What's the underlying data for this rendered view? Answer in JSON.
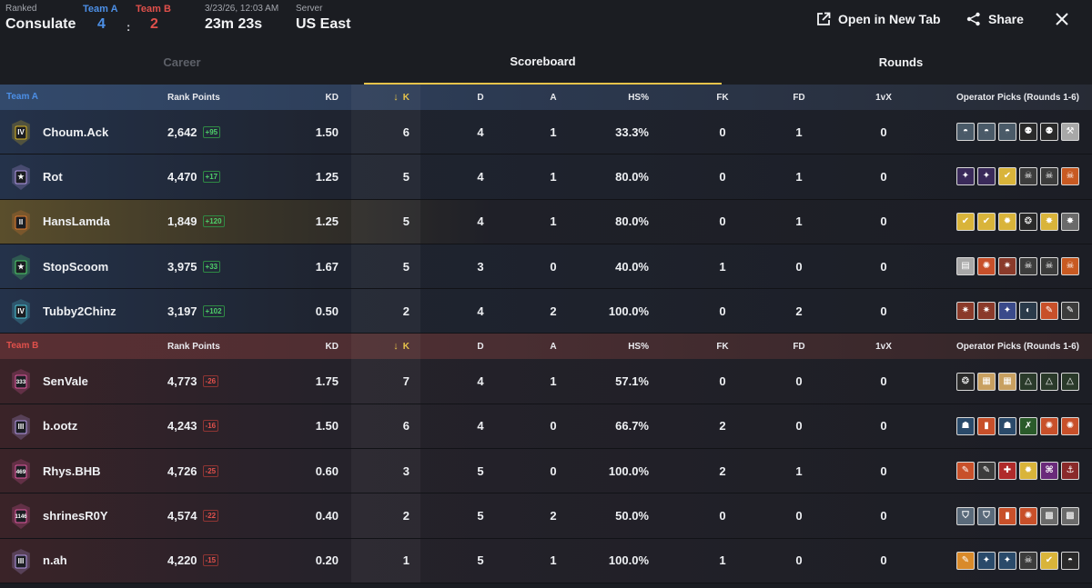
{
  "header": {
    "mode_label": "Ranked",
    "map": "Consulate",
    "team_a_label": "Team A",
    "team_a_score": "4",
    "colon": ":",
    "team_b_label": "Team B",
    "team_b_score": "2",
    "datetime": "3/23/26, 12:03 AM",
    "duration": "23m 23s",
    "server_label": "Server",
    "server": "US East",
    "open_new_tab": "Open in New Tab",
    "share": "Share"
  },
  "tabs": [
    {
      "label": "Career",
      "state": "disabled"
    },
    {
      "label": "Scoreboard",
      "state": "active"
    },
    {
      "label": "Rounds",
      "state": "normal"
    }
  ],
  "columns": {
    "rank_points": "Rank Points",
    "kd": "KD",
    "k": "K",
    "d": "D",
    "a": "A",
    "hs": "HS%",
    "fk": "FK",
    "fd": "FD",
    "vx": "1vX",
    "ops": "Operator Picks (Rounds 1-6)"
  },
  "colors": {
    "team_a": "#4c8fe6",
    "team_b": "#e0504b",
    "accent": "#e6c34a",
    "positive": "#4fcf6a"
  },
  "team_a": {
    "label": "Team A",
    "players": [
      {
        "name": "Choum.Ack",
        "rank_badge": "IV",
        "rank_color": "#d8b323",
        "rp": "2,642",
        "delta": "+95",
        "kd": "1.50",
        "k": "6",
        "d": "4",
        "a": "1",
        "hs": "33.3%",
        "fk": "0",
        "fd": "1",
        "vx": "0",
        "ops": [
          {
            "bg": "#4a5a68",
            "g": "◓"
          },
          {
            "bg": "#4a5a68",
            "g": "◓"
          },
          {
            "bg": "#4a5a68",
            "g": "◓"
          },
          {
            "bg": "#2a2a2a",
            "g": "⚉"
          },
          {
            "bg": "#2a2a2a",
            "g": "⚉"
          },
          {
            "bg": "#a8a8a8",
            "g": "⚒"
          }
        ]
      },
      {
        "name": "Rot",
        "rank_badge": "★",
        "rank_color": "#b49ae6",
        "rp": "4,470",
        "delta": "+17",
        "kd": "1.25",
        "k": "5",
        "d": "4",
        "a": "1",
        "hs": "80.0%",
        "fk": "0",
        "fd": "1",
        "vx": "0",
        "ops": [
          {
            "bg": "#3a2a5a",
            "g": "✦"
          },
          {
            "bg": "#3a2a5a",
            "g": "✦"
          },
          {
            "bg": "#d9b43a",
            "g": "✔"
          },
          {
            "bg": "#3c3c3c",
            "g": "☠"
          },
          {
            "bg": "#3c3c3c",
            "g": "☠"
          },
          {
            "bg": "#c85a22",
            "g": "☠"
          }
        ]
      },
      {
        "name": "HansLamda",
        "rank_badge": "II",
        "rank_color": "#e07a2e",
        "rp": "1,849",
        "delta": "+120",
        "kd": "1.25",
        "k": "5",
        "d": "4",
        "a": "1",
        "hs": "80.0%",
        "fk": "0",
        "fd": "1",
        "vx": "0",
        "ops": [
          {
            "bg": "#d9b43a",
            "g": "✔"
          },
          {
            "bg": "#d9b43a",
            "g": "✔"
          },
          {
            "bg": "#d9b43a",
            "g": "✹"
          },
          {
            "bg": "#2a2a2a",
            "g": "❂"
          },
          {
            "bg": "#d9b43a",
            "g": "✸"
          },
          {
            "bg": "#6a6a6a",
            "g": "✸"
          }
        ]
      },
      {
        "name": "StopScoom",
        "rank_badge": "★",
        "rank_color": "#4fcf6a",
        "rp": "3,975",
        "delta": "+33",
        "kd": "1.67",
        "k": "5",
        "d": "3",
        "a": "0",
        "hs": "40.0%",
        "fk": "1",
        "fd": "0",
        "vx": "0",
        "ops": [
          {
            "bg": "#a8a8a8",
            "g": "▤"
          },
          {
            "bg": "#c8502a",
            "g": "✺"
          },
          {
            "bg": "#8a3a2a",
            "g": "✷"
          },
          {
            "bg": "#3c3c3c",
            "g": "☠"
          },
          {
            "bg": "#3c3c3c",
            "g": "☠"
          },
          {
            "bg": "#c85a22",
            "g": "☠"
          }
        ]
      },
      {
        "name": "Tubby2Chinz",
        "rank_badge": "IV",
        "rank_color": "#4cc6d8",
        "rp": "3,197",
        "delta": "+102",
        "kd": "0.50",
        "k": "2",
        "d": "4",
        "a": "2",
        "hs": "100.0%",
        "fk": "0",
        "fd": "2",
        "vx": "0",
        "ops": [
          {
            "bg": "#8a3a2a",
            "g": "✷"
          },
          {
            "bg": "#8a3a2a",
            "g": "✷"
          },
          {
            "bg": "#3a4a8a",
            "g": "✦"
          },
          {
            "bg": "#2a3a4a",
            "g": "◐"
          },
          {
            "bg": "#c8502a",
            "g": "✎"
          },
          {
            "bg": "#3c3c3c",
            "g": "✎"
          }
        ]
      }
    ]
  },
  "team_b": {
    "label": "Team B",
    "players": [
      {
        "name": "SenVale",
        "rank_badge": "333",
        "rank_color": "#e05aa0",
        "rp": "4,773",
        "delta": "-26",
        "kd": "1.75",
        "k": "7",
        "d": "4",
        "a": "1",
        "hs": "57.1%",
        "fk": "0",
        "fd": "0",
        "vx": "0",
        "ops": [
          {
            "bg": "#2a2a2a",
            "g": "❂"
          },
          {
            "bg": "#c8a060",
            "g": "▦"
          },
          {
            "bg": "#c8a060",
            "g": "▦"
          },
          {
            "bg": "#2a3a2a",
            "g": "△"
          },
          {
            "bg": "#2a3a2a",
            "g": "△"
          },
          {
            "bg": "#2a3a2a",
            "g": "△"
          }
        ]
      },
      {
        "name": "b.ootz",
        "rank_badge": "III",
        "rank_color": "#b49ae6",
        "rp": "4,243",
        "delta": "-16",
        "kd": "1.50",
        "k": "6",
        "d": "4",
        "a": "0",
        "hs": "66.7%",
        "fk": "2",
        "fd": "0",
        "vx": "0",
        "ops": [
          {
            "bg": "#2a4a6a",
            "g": "☗"
          },
          {
            "bg": "#c8502a",
            "g": "▮"
          },
          {
            "bg": "#2a4a6a",
            "g": "☗"
          },
          {
            "bg": "#2a5a2a",
            "g": "✗"
          },
          {
            "bg": "#c8502a",
            "g": "✺"
          },
          {
            "bg": "#c8502a",
            "g": "✺"
          }
        ]
      },
      {
        "name": "Rhys.BHB",
        "rank_badge": "469",
        "rank_color": "#e05aa0",
        "rp": "4,726",
        "delta": "-25",
        "kd": "0.60",
        "k": "3",
        "d": "5",
        "a": "0",
        "hs": "100.0%",
        "fk": "2",
        "fd": "1",
        "vx": "0",
        "ops": [
          {
            "bg": "#c8502a",
            "g": "✎"
          },
          {
            "bg": "#3c3c3c",
            "g": "✎"
          },
          {
            "bg": "#b02a2a",
            "g": "✚"
          },
          {
            "bg": "#d9b43a",
            "g": "✹"
          },
          {
            "bg": "#6a2a7a",
            "g": "⌘"
          },
          {
            "bg": "#8a2a2a",
            "g": "⚓"
          }
        ]
      },
      {
        "name": "shrinesR0Y",
        "rank_badge": "1146",
        "rank_color": "#e05aa0",
        "rp": "4,574",
        "delta": "-22",
        "kd": "0.40",
        "k": "2",
        "d": "5",
        "a": "2",
        "hs": "50.0%",
        "fk": "0",
        "fd": "0",
        "vx": "0",
        "ops": [
          {
            "bg": "#5a6a7a",
            "g": "⛉"
          },
          {
            "bg": "#5a6a7a",
            "g": "⛉"
          },
          {
            "bg": "#c8502a",
            "g": "▮"
          },
          {
            "bg": "#c8502a",
            "g": "✺"
          },
          {
            "bg": "#6a6a6a",
            "g": "▩"
          },
          {
            "bg": "#6a6a6a",
            "g": "▩"
          }
        ]
      },
      {
        "name": "n.ah",
        "rank_badge": "III",
        "rank_color": "#b49ae6",
        "rp": "4,220",
        "delta": "-15",
        "kd": "0.20",
        "k": "1",
        "d": "5",
        "a": "1",
        "hs": "100.0%",
        "fk": "1",
        "fd": "0",
        "vx": "0",
        "ops": [
          {
            "bg": "#d98a2a",
            "g": "✎"
          },
          {
            "bg": "#2a4a6a",
            "g": "✦"
          },
          {
            "bg": "#2a4a6a",
            "g": "✦"
          },
          {
            "bg": "#3c3c3c",
            "g": "☠"
          },
          {
            "bg": "#d9b43a",
            "g": "✔"
          },
          {
            "bg": "#2a2a2a",
            "g": "◓"
          }
        ]
      }
    ]
  }
}
